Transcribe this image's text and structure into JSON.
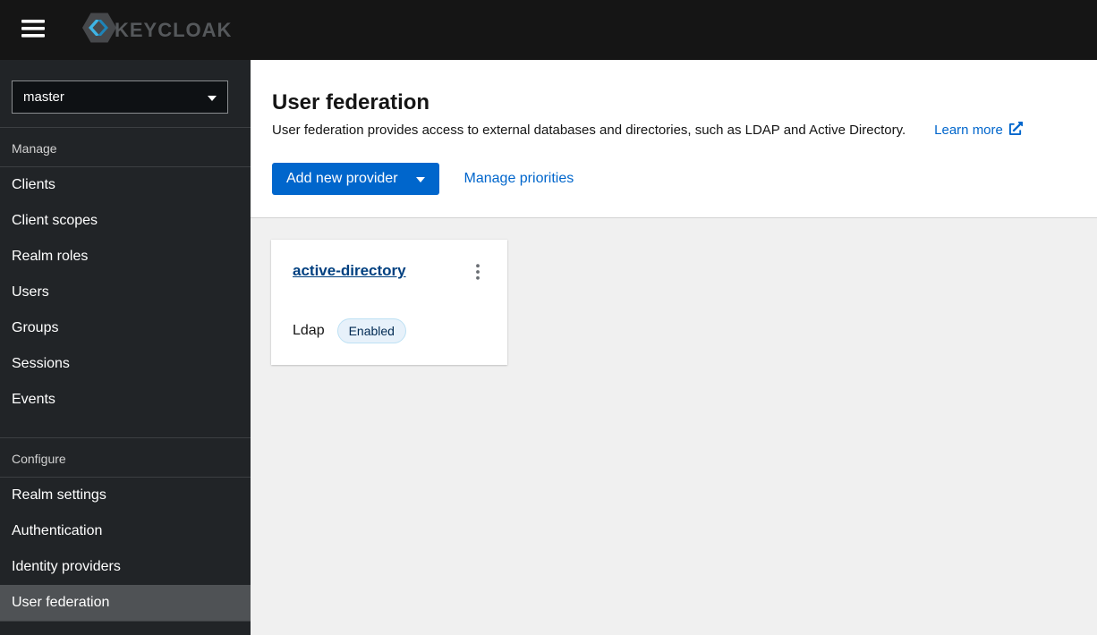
{
  "masthead": {
    "logo_text": "KEYCLOAK"
  },
  "sidebar": {
    "realm_selector": {
      "value": "master"
    },
    "sections": [
      {
        "label": "Manage",
        "items": [
          {
            "label": "Clients"
          },
          {
            "label": "Client scopes"
          },
          {
            "label": "Realm roles"
          },
          {
            "label": "Users"
          },
          {
            "label": "Groups"
          },
          {
            "label": "Sessions"
          },
          {
            "label": "Events"
          }
        ]
      },
      {
        "label": "Configure",
        "items": [
          {
            "label": "Realm settings"
          },
          {
            "label": "Authentication"
          },
          {
            "label": "Identity providers"
          },
          {
            "label": "User federation",
            "current": true
          }
        ]
      }
    ]
  },
  "main": {
    "title": "User federation",
    "description": "User federation provides access to external databases and directories, such as LDAP and Active Directory.",
    "learn_more_label": "Learn more",
    "add_provider_label": "Add new provider",
    "manage_priorities_label": "Manage priorities",
    "cards": [
      {
        "title": "active-directory",
        "type_label": "Ldap",
        "status_label": "Enabled"
      }
    ]
  },
  "colors": {
    "accent_blue": "#0066cc",
    "masthead_bg": "#151515",
    "sidebar_bg": "#212427",
    "nav_current_bg": "#4f5255",
    "content_bg": "#f0f0f0",
    "header_bg": "#ffffff",
    "badge_bg": "#e7f1fa",
    "badge_text": "#002952",
    "card_link": "#004080"
  }
}
